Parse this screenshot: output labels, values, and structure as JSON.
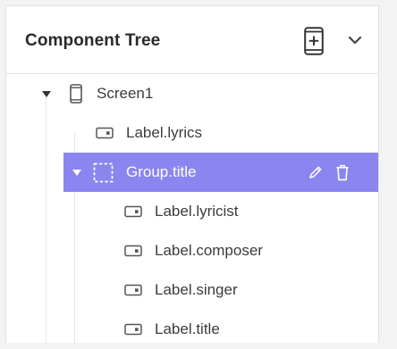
{
  "panel": {
    "title": "Component Tree",
    "add_icon": "phone-plus-icon",
    "collapse_icon": "chevron-down-icon"
  },
  "tree": {
    "nodes": [
      {
        "label": "Screen1",
        "type": "screen",
        "icon": "phone-icon",
        "expanded": true,
        "selected": false
      },
      {
        "label": "Label.lyrics",
        "type": "label",
        "icon": "label-icon",
        "selected": false
      },
      {
        "label": "Group.title",
        "type": "group",
        "icon": "dashed-square-icon",
        "expanded": true,
        "selected": true,
        "actions": [
          "pencil-icon",
          "trash-icon"
        ]
      },
      {
        "label": "Label.lyricist",
        "type": "label",
        "icon": "label-icon",
        "selected": false
      },
      {
        "label": "Label.composer",
        "type": "label",
        "icon": "label-icon",
        "selected": false
      },
      {
        "label": "Label.singer",
        "type": "label",
        "icon": "label-icon",
        "selected": false
      },
      {
        "label": "Label.title",
        "type": "label",
        "icon": "label-icon",
        "selected": false
      }
    ]
  },
  "colors": {
    "selected_bg": "#8b85f0",
    "selected_text": "#ffffff",
    "text": "#3c3c3c"
  }
}
